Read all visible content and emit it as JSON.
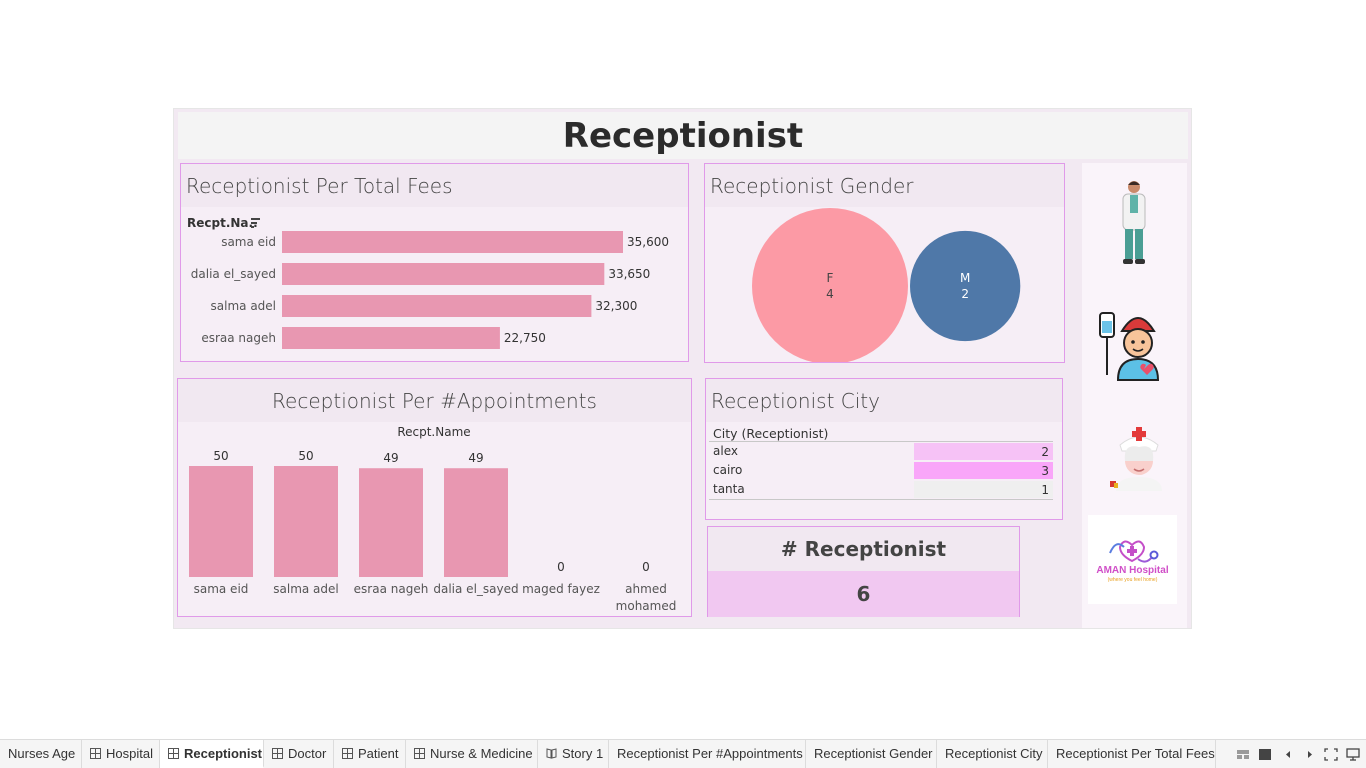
{
  "dashboard": {
    "title": "Receptionist"
  },
  "fees_panel": {
    "title": "Receptionist Per Total Fees",
    "axis_header": "Recpt.Na..",
    "sort_icon": "sort-descending-icon"
  },
  "gender_panel": {
    "title": "Receptionist Gender"
  },
  "appointments_panel": {
    "title": "Receptionist Per #Appointments",
    "axis_header": "Recpt.Name"
  },
  "city_panel": {
    "title": "Receptionist City",
    "column_header": "City (Receptionist)",
    "rows": [
      {
        "city": "alex",
        "count": "2",
        "color": "#f6c2f6"
      },
      {
        "city": "cairo",
        "count": "3",
        "color": "#f9a6f9"
      },
      {
        "city": "tanta",
        "count": "1",
        "color": "#efefef"
      }
    ]
  },
  "kpi_panel": {
    "title": "# Receptionist",
    "value": "6"
  },
  "images": {
    "doctor": "doctor-illustration",
    "patient": "patient-with-iv-illustration",
    "nurse": "nurse-illustration",
    "logo": "aman-hospital-logo",
    "logo_name": "AMAN Hospital",
    "logo_tagline": "(where you feel home)"
  },
  "colors": {
    "bar_pink": "#e897b1",
    "female": "#fc9aa5",
    "male": "#4f78a8",
    "panel_border": "#e09ae9"
  },
  "chart_data": [
    {
      "type": "bar",
      "orientation": "horizontal",
      "title": "Receptionist Per Total Fees",
      "ylabel": "Recpt.Na..",
      "categories": [
        "sama eid",
        "dalia el_sayed",
        "salma adel",
        "esraa nageh"
      ],
      "values": [
        35600,
        33650,
        32300,
        22750
      ],
      "value_labels": [
        "35,600",
        "33,650",
        "32,300",
        "22,750"
      ]
    },
    {
      "type": "bubble",
      "title": "Receptionist Gender",
      "categories": [
        "F",
        "M"
      ],
      "values": [
        4,
        2
      ]
    },
    {
      "type": "bar",
      "title": "Receptionist Per #Appointments",
      "xlabel": "Recpt.Name",
      "categories": [
        "sama eid",
        "salma adel",
        "esraa nageh",
        "dalia el_sayed",
        "maged fayez",
        "ahmed mohamed"
      ],
      "category_lines": [
        [
          "sama eid"
        ],
        [
          "salma adel"
        ],
        [
          "esraa nageh"
        ],
        [
          "dalia el_sayed"
        ],
        [
          "maged fayez"
        ],
        [
          "ahmed",
          "mohamed"
        ]
      ],
      "values": [
        50,
        50,
        49,
        49,
        0,
        0
      ]
    }
  ],
  "tabs": [
    {
      "label": "Nurses Age",
      "icon": "",
      "active": false
    },
    {
      "label": "Hospital",
      "icon": "dashboard-icon",
      "active": false
    },
    {
      "label": "Receptionist",
      "icon": "dashboard-icon",
      "active": true
    },
    {
      "label": "Doctor",
      "icon": "dashboard-icon",
      "active": false
    },
    {
      "label": "Patient",
      "icon": "dashboard-icon",
      "active": false
    },
    {
      "label": "Nurse & Medicine",
      "icon": "dashboard-icon",
      "active": false
    },
    {
      "label": "Story 1",
      "icon": "story-icon",
      "active": false
    },
    {
      "label": "Receptionist Per #Appointments",
      "icon": "",
      "active": false
    },
    {
      "label": "Receptionist Gender",
      "icon": "",
      "active": false
    },
    {
      "label": "Receptionist City",
      "icon": "",
      "active": false
    },
    {
      "label": "Receptionist Per Total Fees",
      "icon": "",
      "active": false
    }
  ],
  "nav_controls": [
    "sheet-sorter-icon",
    "filmstrip-icon",
    "previous-sheet-icon",
    "next-sheet-icon",
    "fullscreen-icon",
    "presentation-mode-icon"
  ]
}
